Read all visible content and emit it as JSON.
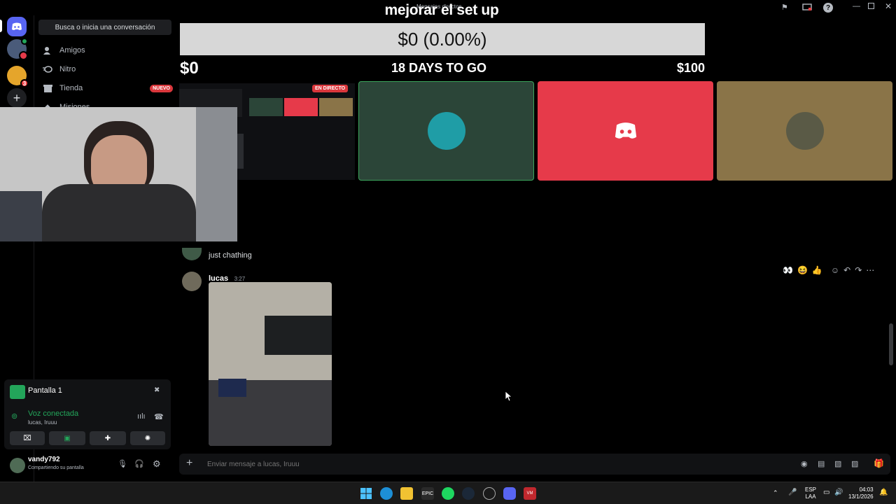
{
  "window": {
    "title": "Mensajes directos"
  },
  "overlay": {
    "title": "mejorar el set up",
    "goal_amount": "$0 (0.00%)",
    "goal_start": "$0",
    "goal_days": "18 DAYS TO GO",
    "goal_end": "$100"
  },
  "stream_tile": {
    "live_label": "EN DIRECTO"
  },
  "tiles": [
    {
      "color": "#2b4538"
    },
    {
      "color": "#e63a4a"
    },
    {
      "color": "#8a7448"
    }
  ],
  "sidebar": {
    "search_label": "Busca o inicia una conversación",
    "items": [
      {
        "label": "Amigos",
        "icon": "friends-icon"
      },
      {
        "label": "Nitro",
        "icon": "nitro-icon"
      },
      {
        "label": "Tienda",
        "icon": "shop-icon",
        "badge": "NUEVO"
      },
      {
        "label": "Misiones",
        "icon": "quests-icon"
      }
    ]
  },
  "voice": {
    "stream_label": "Pantalla 1",
    "status": "Voz conectada",
    "channel": "lucas, Iruuu"
  },
  "user": {
    "name": "vandy792",
    "status": "Compartiendo su pantalla"
  },
  "messages": [
    {
      "text": "just chathing"
    },
    {
      "author": "lucas",
      "time": "3:27"
    }
  ],
  "compose": {
    "placeholder": "Enviar mensaje a lucas, Iruuu"
  },
  "taskbar": {
    "lang_top": "ESP",
    "lang_bottom": "LAA",
    "time": "04:03",
    "date": "13/1/2026"
  },
  "rail": {
    "badge_count": "3"
  },
  "colors": {
    "blurple": "#5865f2",
    "green": "#23a55a",
    "red": "#da373c"
  }
}
